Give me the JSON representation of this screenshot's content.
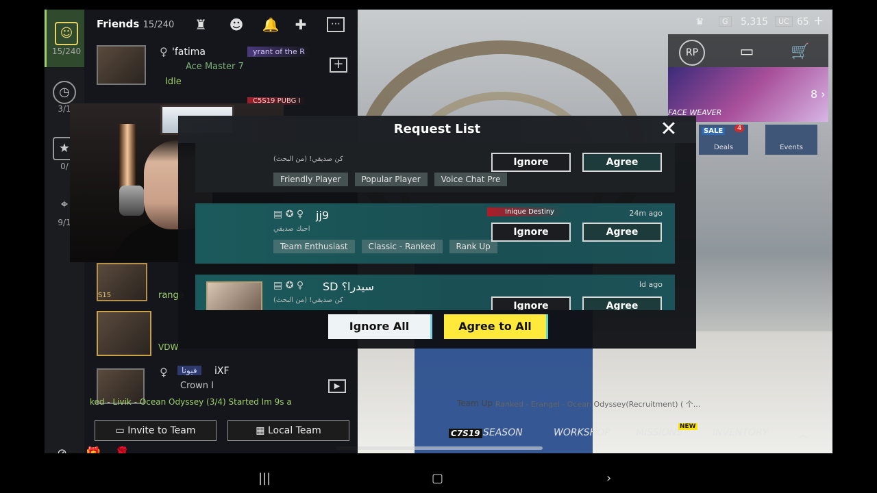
{
  "friends_panel": {
    "title": "Friends",
    "count": "15/240",
    "rail": {
      "top_count": "15/240",
      "recent_count": "3/1",
      "clan_count": "0/",
      "nearby_count": "9/1"
    },
    "friends": [
      {
        "name": "'fatima",
        "title": "yrant of the R",
        "rank": "Ace Master",
        "rank_level": "7",
        "status": "Idle"
      },
      {
        "name": "",
        "title": "C5S19 PUBG I",
        "rank": "",
        "status": ""
      },
      {
        "name": "",
        "tier": "S15",
        "status_line": "range"
      },
      {
        "name": "",
        "status_line": "VDW"
      },
      {
        "name": "iXF",
        "tag": "فيونا",
        "rank": "Crown I",
        "status_line": "ked - Livik - Ocean Odyssey (3/4) Started Im 9s a"
      }
    ],
    "invite_button": "Invite to Team",
    "local_team_button": "Local Team"
  },
  "dialog": {
    "title": "Request List",
    "ignore_all": "Ignore All",
    "agree_to_all": "Agree to All",
    "requests": [
      {
        "sub": "كن صديقي! (من البحث)",
        "tags": [
          "Friendly Player",
          "Popular Player",
          "Voice Chat Pre"
        ],
        "ignore": "Ignore",
        "agree": "Agree"
      },
      {
        "name": "jj9",
        "sub": "احبك صديقي",
        "title_badge": "Inique Destiny",
        "time": "24m ago",
        "tags": [
          "Team Enthusiast",
          "Classic - Ranked",
          "Rank Up"
        ],
        "ignore": "Ignore",
        "agree": "Agree"
      },
      {
        "name": "SD سيدرا؟",
        "sub": "كن صديقي! (من البحث)",
        "time": "Id ago",
        "ignore": "Ignore",
        "agree": "Agree"
      }
    ]
  },
  "hud": {
    "bp": "5,315",
    "uc": "65",
    "rp_label": "RP",
    "promo_label": "FACE WEAVER",
    "promo_count": "8",
    "deals_label": "Deals",
    "deals_badge": "4",
    "events_label": "Events",
    "sale_label": "SALE"
  },
  "bottom_nav": {
    "season_prefix": "C7S19",
    "season": "SEASON",
    "workshop": "WORKSHOP",
    "missions": "MISSIONS",
    "missions_badge": "NEW",
    "inventory": "INVENTORY",
    "team_up": "Team Up",
    "team_status": "Ranked - Erangel - Ocean Odyssey(Recruitment) ( 个..."
  }
}
